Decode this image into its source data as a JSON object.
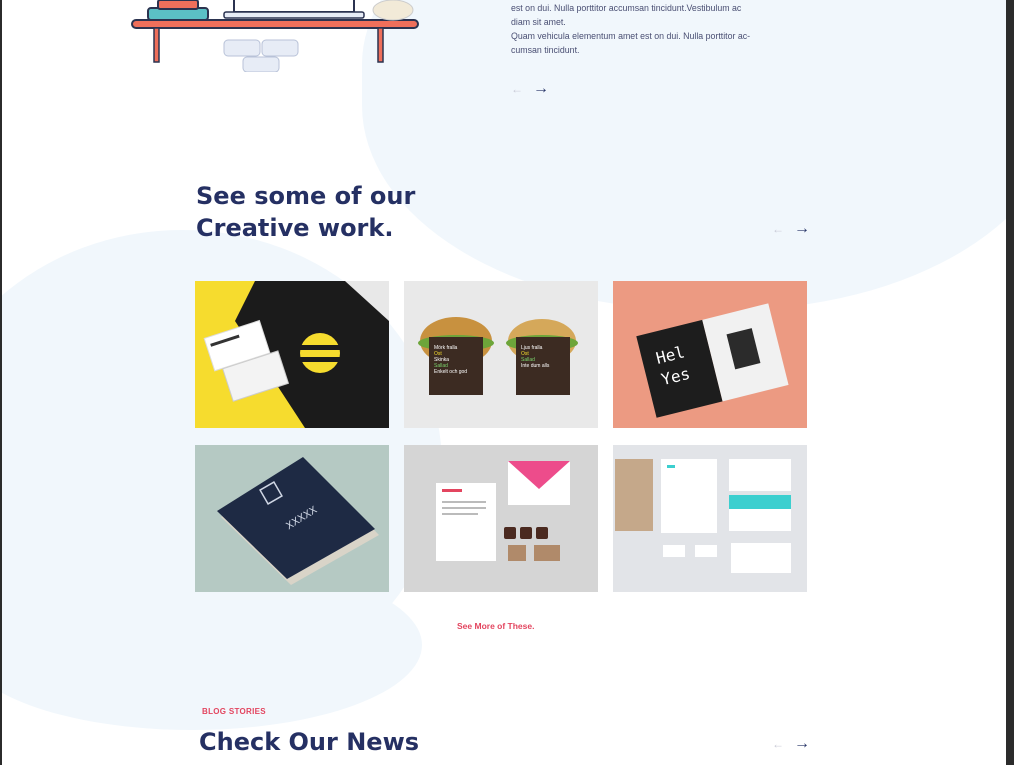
{
  "intro": {
    "line1": "est on dui. Nulla porttitor accumsan tincidunt.Vestibulum ac",
    "line2": "diam sit amet.",
    "line3": "Quam vehicula elementum amet est on dui. Nulla porttitor ac-",
    "line4": "cumsan tincidunt."
  },
  "work": {
    "title_line1": "See some of our",
    "title_line2": "Creative work.",
    "see_more": "See More of These.",
    "tiles": [
      {
        "name": "yellow-business-cards"
      },
      {
        "name": "sandwich-packaging",
        "box1": [
          "Mörk fralla",
          "Ost",
          "Skinka",
          "Sallad",
          "Enkelt och god"
        ],
        "box2": [
          "Ljus fralla",
          "Ost",
          "Sallad",
          "Inte dum alls"
        ]
      },
      {
        "name": "hello-yes-brochure",
        "text1": "Hel",
        "text2": "Yes"
      },
      {
        "name": "navy-book",
        "text": "XXXXX"
      },
      {
        "name": "pink-stationery"
      },
      {
        "name": "teal-stationery"
      }
    ]
  },
  "news": {
    "kicker": "BLOG STORIES",
    "title": "Check Our News"
  },
  "icons": {
    "prev": "←",
    "next": "→"
  },
  "colors": {
    "heading": "#253063",
    "accent": "#e3455f",
    "blob": "#f1f7fc"
  }
}
